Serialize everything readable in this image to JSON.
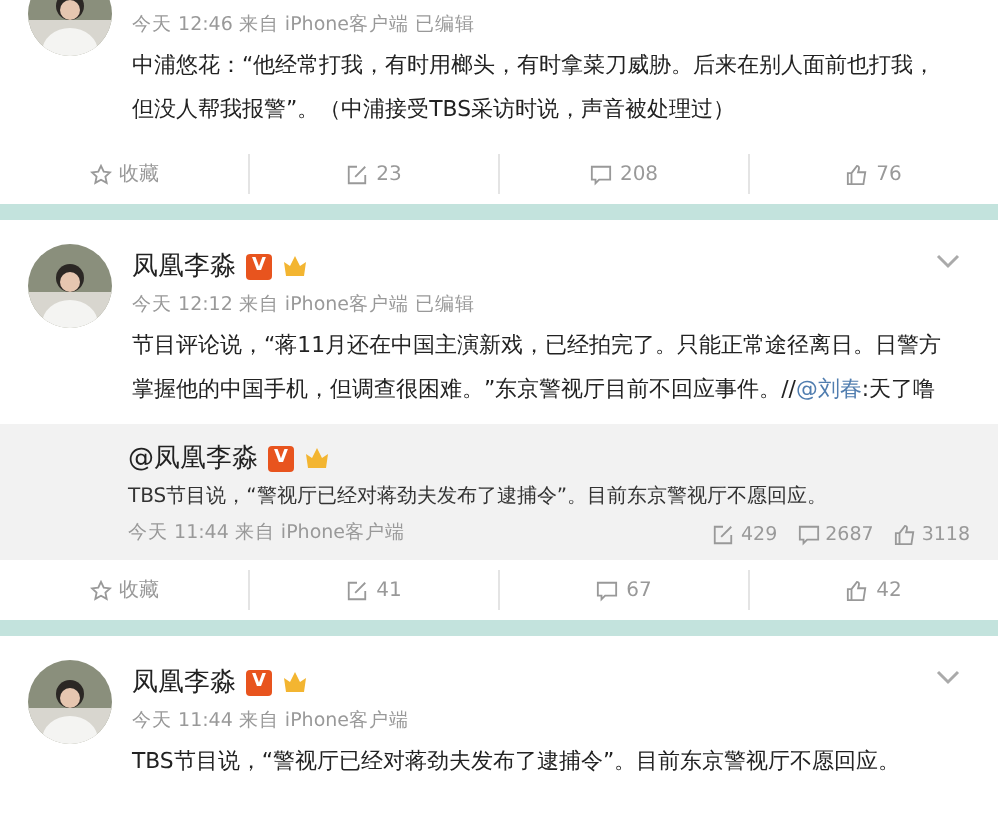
{
  "posts": [
    {
      "meta": "今天 12:46 来自 iPhone客户端  已编辑",
      "text": "中浦悠花：“他经常打我，有时用榔头，有时拿菜刀威胁。后来在别人面前也打我，但没人帮我报警”。（中浦接受TBS采访时说，声音被处理过）",
      "actions": {
        "favorite": "收藏",
        "reposts": "23",
        "comments": "208",
        "likes": "76"
      }
    },
    {
      "author": "凤凰李淼",
      "verified": "V",
      "meta": "今天 12:12 来自 iPhone客户端  已编辑",
      "text": "节目评论说，“蒋11月还在中国主演新戏，已经拍完了。只能正常途径离日。日警方掌握他的中国手机，但调查很困难。”东京警视厅目前不回应事件。//",
      "mention": "@刘春",
      "mention_tail": ":天了噜",
      "quote": {
        "author": "@凤凰李淼",
        "verified": "V",
        "text": "TBS节目说，“警视厅已经对蒋劲夫发布了逮捕令”。目前东京警视厅不愿回应。",
        "meta": "今天 11:44 来自 iPhone客户端",
        "reposts": "429",
        "comments": "2687",
        "likes": "3118"
      },
      "actions": {
        "favorite": "收藏",
        "reposts": "41",
        "comments": "67",
        "likes": "42"
      }
    },
    {
      "author": "凤凰李淼",
      "verified": "V",
      "meta": "今天 11:44 来自 iPhone客户端",
      "text": "TBS节目说，“警视厅已经对蒋劲夫发布了逮捕令”。目前东京警视厅不愿回应。"
    }
  ]
}
